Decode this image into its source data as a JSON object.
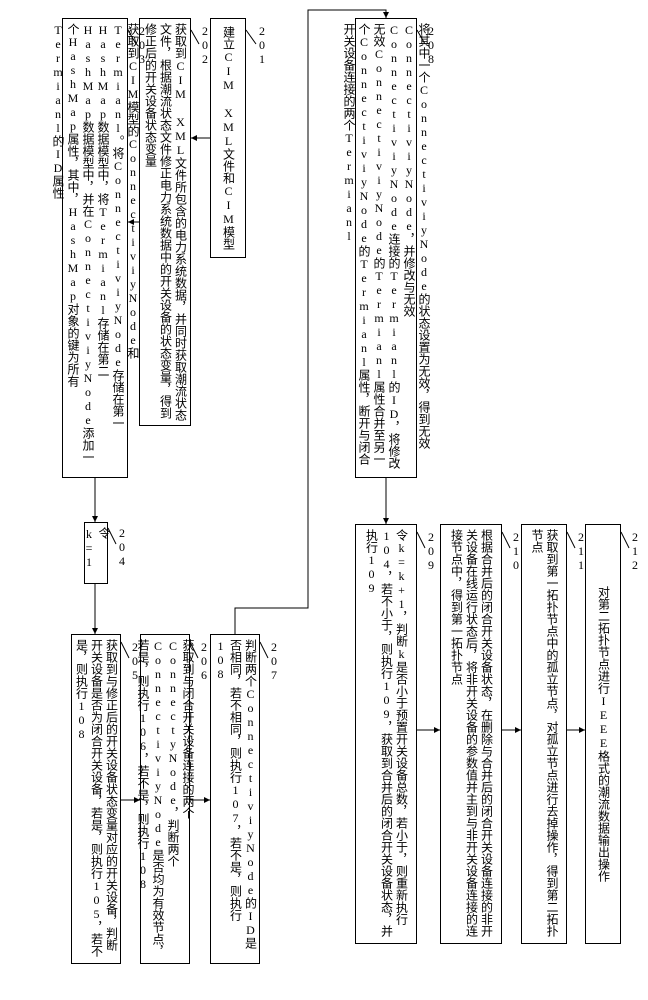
{
  "steps": {
    "s201": {
      "num": "201",
      "text": "建立CIM XML文件和CIM模型"
    },
    "s202": {
      "num": "202",
      "text": "获取到CIM XML文件所包含的电力系统数据，并同时获取潮流状态文件，根据潮流状态文件修正电力系统数据中的开关设备的状态变量，得到修正后的开关设备状态变量"
    },
    "s203": {
      "num": "203",
      "text": "获取到CIM模型的ConnectiviyNode和Termianl。将ConnectiviyNode存储在第一HashMap数据模型中，将Termianl存储在第二HashMap数据模型中，并在ConnectiviyNode添加一个HashMap属性，其中，HashMap对象的键为所有Termianl的ID属性"
    },
    "s204": {
      "num": "204",
      "text": "令k=1"
    },
    "s205": {
      "num": "205",
      "text": "获取到与修正后的开关设备状态变量对应的开关设备，判断开关设备是否为闭合开关设备，若是，则执行105，若不是，则执行108"
    },
    "s206": {
      "num": "206",
      "text": "获取到与闭合开关设备连接的两个ConnectyNode，判断两个ConnectiviyNode是否均为有效节点，若是，则执行106，若不是，则执行108"
    },
    "s207": {
      "num": "207",
      "text": "判断两个ConnectiviyNode的ID是否相同，若不相同，则执行107，若不是，则执行108"
    },
    "s208": {
      "num": "208",
      "text": "将其中一个ConnectiviyNode的状态设置为无效，得到无效ConnectiviyNode，并修改与无效ConnectiviyNode连接的Termianl的ID，将修改无效ConnectiviyNode的Termianl属性合并至另一个ConnectiviyNode的Termianl属性，断开与闭合开关设备连接的两个Termianl"
    },
    "s209": {
      "num": "209",
      "text": "令k=k+1，判断k是否小于预置开关设备总数，若小于，则重新执行104，若不小于，则执行109，获取到合并后的闭合开关设备状态，并执行109"
    },
    "s210": {
      "num": "210",
      "text": "根据合并后的闭合开关设备状态，在删除与合并后的闭合开关设备连接的非开关设备在线运行状态后，将非开关设备的参数值并主到与非开关设备连接的连接节点中，得到第一拓扑节点"
    },
    "s211": {
      "num": "211",
      "text": "获取到第一拓扑节点中的孤立节点，对孤立节点进行去掉操作，得到第二拓扑节点"
    },
    "s212": {
      "num": "212",
      "text": "对第二拓扑节点进行IEEE格式的潮流数据输出操作"
    }
  }
}
